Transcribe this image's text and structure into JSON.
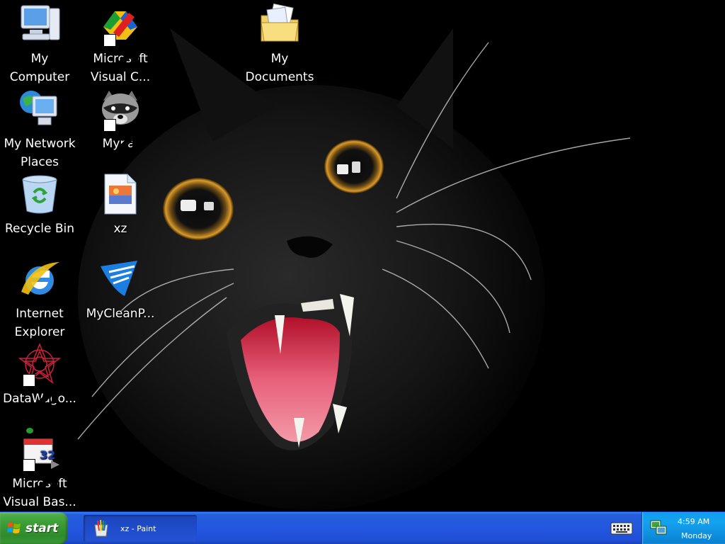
{
  "desktop": {
    "icons": [
      {
        "id": "my-computer",
        "label": "My\nComputer",
        "icon": "my-computer-icon",
        "shortcut": false
      },
      {
        "id": "ms-visual-c",
        "label": "Microsoft\nVisual C...",
        "icon": "visual-cpp-icon",
        "shortcut": true
      },
      {
        "id": "my-documents",
        "label": "My\nDocuments",
        "icon": "folder-documents-icon",
        "shortcut": false
      },
      {
        "id": "my-network-places",
        "label": "My Network\nPlaces",
        "icon": "network-places-icon",
        "shortcut": false
      },
      {
        "id": "mypal",
        "label": "Mypal",
        "icon": "raccoon-icon",
        "shortcut": true
      },
      {
        "id": "recycle-bin",
        "label": "Recycle Bin",
        "icon": "recycle-bin-icon",
        "shortcut": false
      },
      {
        "id": "xz",
        "label": "xz",
        "icon": "image-file-icon",
        "shortcut": false
      },
      {
        "id": "internet-explorer",
        "label": "Internet\nExplorer",
        "icon": "internet-explorer-icon",
        "shortcut": false
      },
      {
        "id": "mycleanpc",
        "label": "MyCleanP...",
        "icon": "shield-wing-icon",
        "shortcut": false
      },
      {
        "id": "datawagon",
        "label": "DataWago...",
        "icon": "star-pattern-icon",
        "shortcut": true
      },
      {
        "id": "ms-visual-basic",
        "label": "Microsoft\nVisual Bas...",
        "icon": "visual-basic-icon",
        "shortcut": true
      }
    ]
  },
  "taskbar": {
    "start_label": "start",
    "tasks": [
      {
        "label": "xz - Paint",
        "icon": "paint-icon"
      }
    ],
    "tray": {
      "time": "4:59 AM",
      "day": "Monday"
    }
  },
  "colors": {
    "taskbar_blue": "#245edb",
    "start_green": "#3a9a35",
    "tray_blue": "#0f9df1"
  }
}
